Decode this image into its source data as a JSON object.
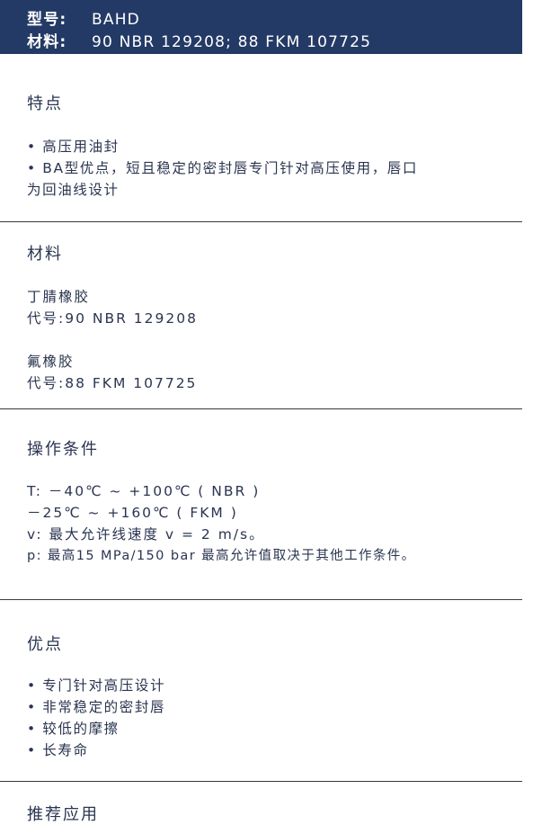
{
  "header": {
    "model_label": "型号:",
    "model_value": "BAHD",
    "material_label": "材料:",
    "material_value": "90 NBR 129208; 88 FKM 107725"
  },
  "features": {
    "title": "特点",
    "items": [
      "• 高压用油封",
      "• BA型优点，短且稳定的密封唇专门针对高压使用，唇口",
      "为回油线设计"
    ]
  },
  "materials": {
    "title": "材料",
    "lines": [
      "丁腈橡胶",
      "代号:90 NBR 129208",
      "氟橡胶",
      "代号:88 FKM 107725"
    ]
  },
  "conditions": {
    "title": "操作条件",
    "lines": [
      "T:   －40℃ ~ +100℃ ( NBR )",
      "       －25℃ ~ +160℃ ( FKM )",
      "v:  最大允许线速度 v = 2  m/s。",
      "p:  最高15  MPa/150  bar   最高允许值取决于其他工作条件。"
    ]
  },
  "advantages": {
    "title": "优点",
    "items": [
      "• 专门针对高压设计",
      "• 非常稳定的密封唇",
      "• 较低的摩擦",
      "• 长寿命"
    ]
  },
  "applications": {
    "title": "推荐应用"
  }
}
